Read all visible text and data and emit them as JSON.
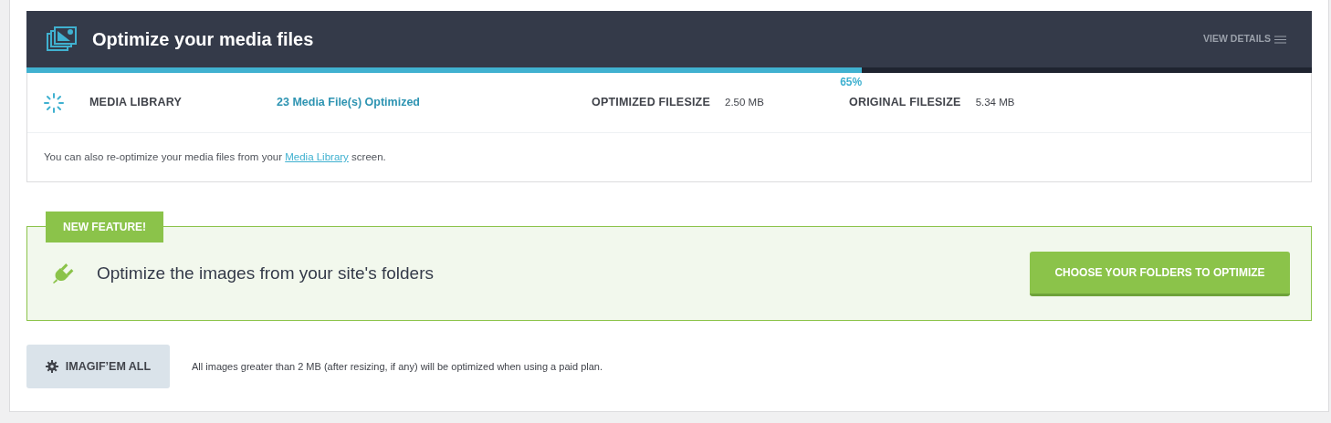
{
  "header": {
    "title": "Optimize your media files",
    "view_details": "VIEW DETAILS"
  },
  "progress": {
    "level": 0.65,
    "percent": "65%"
  },
  "media_row": {
    "label": "MEDIA LIBRARY",
    "optimized_count": "23 Media File(s) Optimized",
    "optimized_filesize_label": "OPTIMIZED FILESIZE",
    "optimized_filesize": "2.50 MB",
    "original_filesize_label": "ORIGINAL FILESIZE",
    "original_filesize": "5.34 MB"
  },
  "note": {
    "before": "You can also re-optimize your media files from your ",
    "link": "Media Library",
    "after": " screen."
  },
  "feature": {
    "badge": "NEW FEATURE!",
    "title": "Optimize the images from your site's folders",
    "button": "CHOOSE YOUR FOLDERS TO OPTIMIZE"
  },
  "bulk": {
    "button": "IMAGIF’EM ALL",
    "note": "All images greater than 2 MB (after resizing, if any) will be optimized when using a paid plan."
  }
}
